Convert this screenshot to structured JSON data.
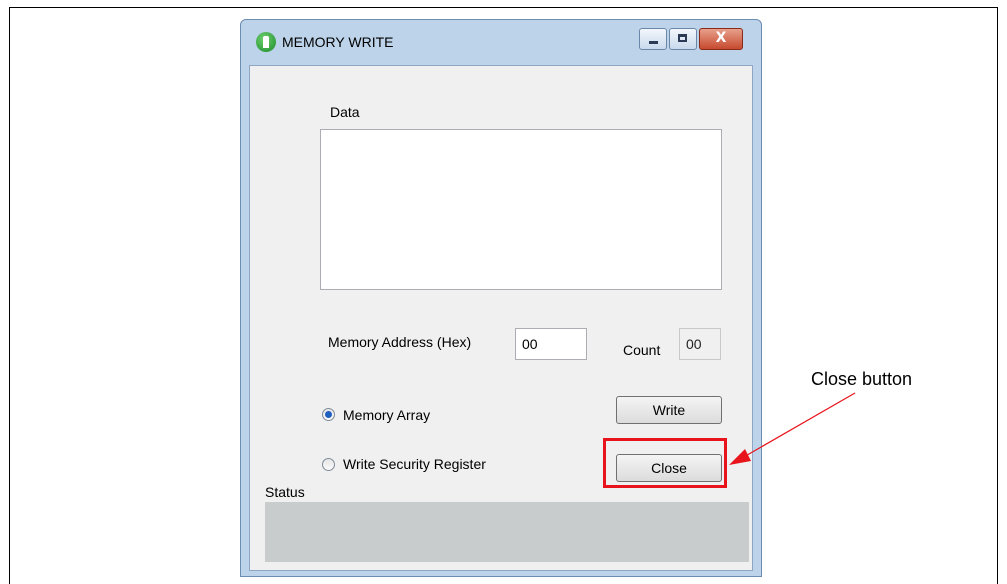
{
  "window": {
    "title": "MEMORY WRITE",
    "close_glyph": "X"
  },
  "form": {
    "data_label": "Data",
    "data_value": "",
    "address_label": "Memory Address (Hex)",
    "address_value": "00",
    "count_label": "Count",
    "count_value": "00",
    "radio_memory_array": "Memory Array",
    "radio_security_register": "Write Security Register",
    "selected_radio": "Memory Array",
    "write_button": "Write",
    "close_button": "Close",
    "status_label": "Status",
    "status_value": ""
  },
  "annotation": {
    "callout_text": "Close button",
    "highlight_color": "#e8141c"
  },
  "icons": [
    "app-icon",
    "minimize-icon",
    "maximize-icon",
    "close-icon"
  ]
}
